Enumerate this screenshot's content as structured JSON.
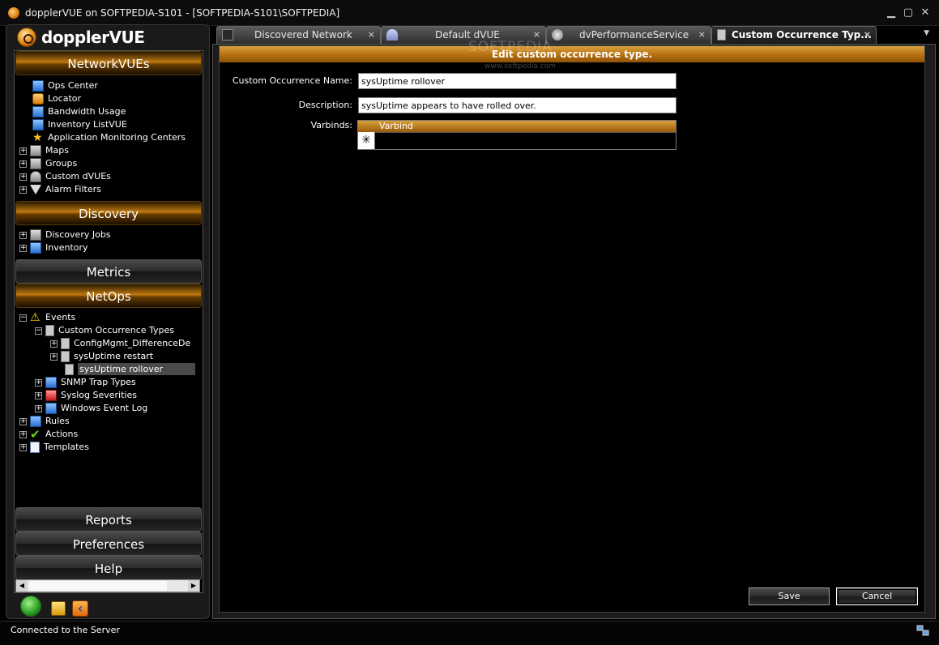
{
  "window": {
    "title": "dopplerVUE on SOFTPEDIA-S101 - [SOFTPEDIA-S101\\SOFTPEDIA]",
    "minimize_glyph": "▁",
    "maximize_glyph": "▢",
    "close_glyph": "✕"
  },
  "brand": "dopplerVUE",
  "sections": {
    "networkvues": "NetworkVUEs",
    "discovery": "Discovery",
    "metrics": "Metrics",
    "netops": "NetOps",
    "reports": "Reports",
    "preferences": "Preferences",
    "help": "Help"
  },
  "networkvues_items": [
    {
      "label": "Ops Center"
    },
    {
      "label": "Locator"
    },
    {
      "label": "Bandwidth Usage"
    },
    {
      "label": "Inventory ListVUE"
    },
    {
      "label": "Application Monitoring Centers"
    },
    {
      "label": "Maps"
    },
    {
      "label": "Groups"
    },
    {
      "label": "Custom dVUEs"
    },
    {
      "label": "Alarm Filters"
    }
  ],
  "discovery_items": [
    {
      "label": "Discovery Jobs"
    },
    {
      "label": "Inventory"
    }
  ],
  "netops_items": [
    {
      "label": "Events"
    },
    {
      "label": "Custom Occurrence Types"
    },
    {
      "label": "ConfigMgmt_DifferenceDe"
    },
    {
      "label": "sysUptime restart"
    },
    {
      "label": "sysUptime rollover"
    },
    {
      "label": "SNMP Trap Types"
    },
    {
      "label": "Syslog Severities"
    },
    {
      "label": "Windows Event Log"
    },
    {
      "label": "Rules"
    },
    {
      "label": "Actions"
    },
    {
      "label": "Templates"
    }
  ],
  "tree_glyphs": {
    "plus": "+",
    "minus": "−"
  },
  "scroll": {
    "left": "◀",
    "right": "▶"
  },
  "tabs": [
    {
      "label": "Discovered Network"
    },
    {
      "label": "Default dVUE"
    },
    {
      "label": "dvPerformanceService"
    },
    {
      "label": "Custom Occurrence Typ..."
    }
  ],
  "tab_close": "×",
  "tab_menu": "▼",
  "watermark": {
    "text": "SOFTPEDIA",
    "url": "www.softpedia.com"
  },
  "form": {
    "banner": "Edit custom occurrence type.",
    "name_label": "Custom Occurrence Name:",
    "name_value": "sysUptime rollover",
    "description_label": "Description:",
    "description_value": "sysUptime appears to have rolled over.",
    "varbinds_label": "Varbinds:",
    "varbind_column": "Varbind",
    "new_row_marker": "✳",
    "save": "Save",
    "cancel": "Cancel"
  },
  "status": "Connected to the Server",
  "colors": {
    "accent": "#c07a10",
    "background": "#000000"
  }
}
